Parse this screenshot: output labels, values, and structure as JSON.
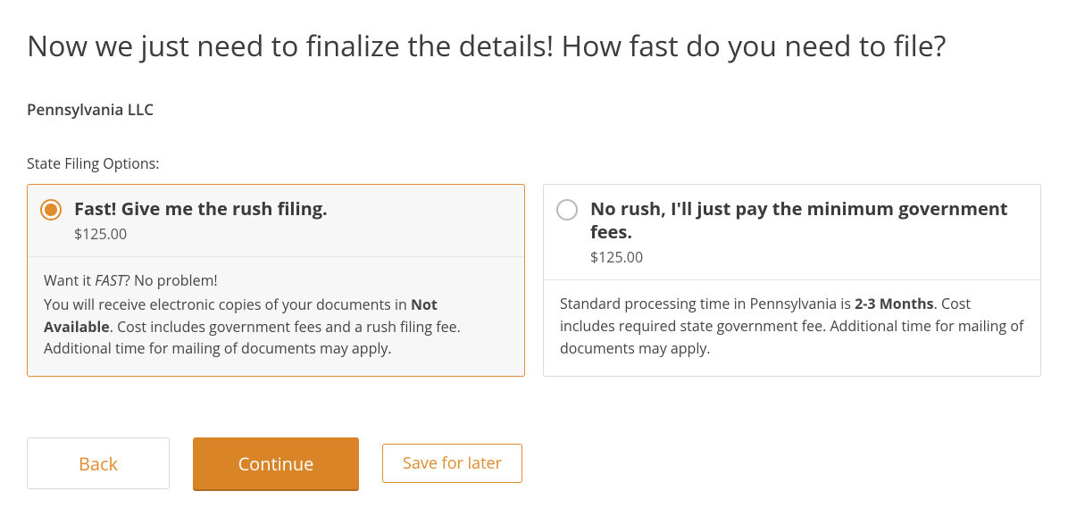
{
  "header": {
    "title": "Now we just need to finalize the details! How fast do you need to file?",
    "subtitle": "Pennsylvania LLC"
  },
  "section_label": "State Filing Options:",
  "options": [
    {
      "title": "Fast! Give me the rush filing.",
      "price": "$125.00",
      "intro_prefix": "Want it ",
      "intro_em": "FAST",
      "intro_suffix": "? No problem!",
      "desc_prefix": "You will receive electronic copies of your documents in ",
      "desc_bold": "Not Available",
      "desc_suffix": ". Cost includes government fees and a rush filing fee. Additional time for mailing of documents may apply.",
      "selected": true
    },
    {
      "title": "No rush, I'll just pay the minimum government fees.",
      "price": "$125.00",
      "desc_prefix": "Standard processing time in Pennsylvania is ",
      "desc_bold": "2-3 Months",
      "desc_suffix": ". Cost includes required state government fee. Additional time for mailing of documents may apply.",
      "selected": false
    }
  ],
  "actions": {
    "back": "Back",
    "continue": "Continue",
    "save": "Save for later"
  }
}
